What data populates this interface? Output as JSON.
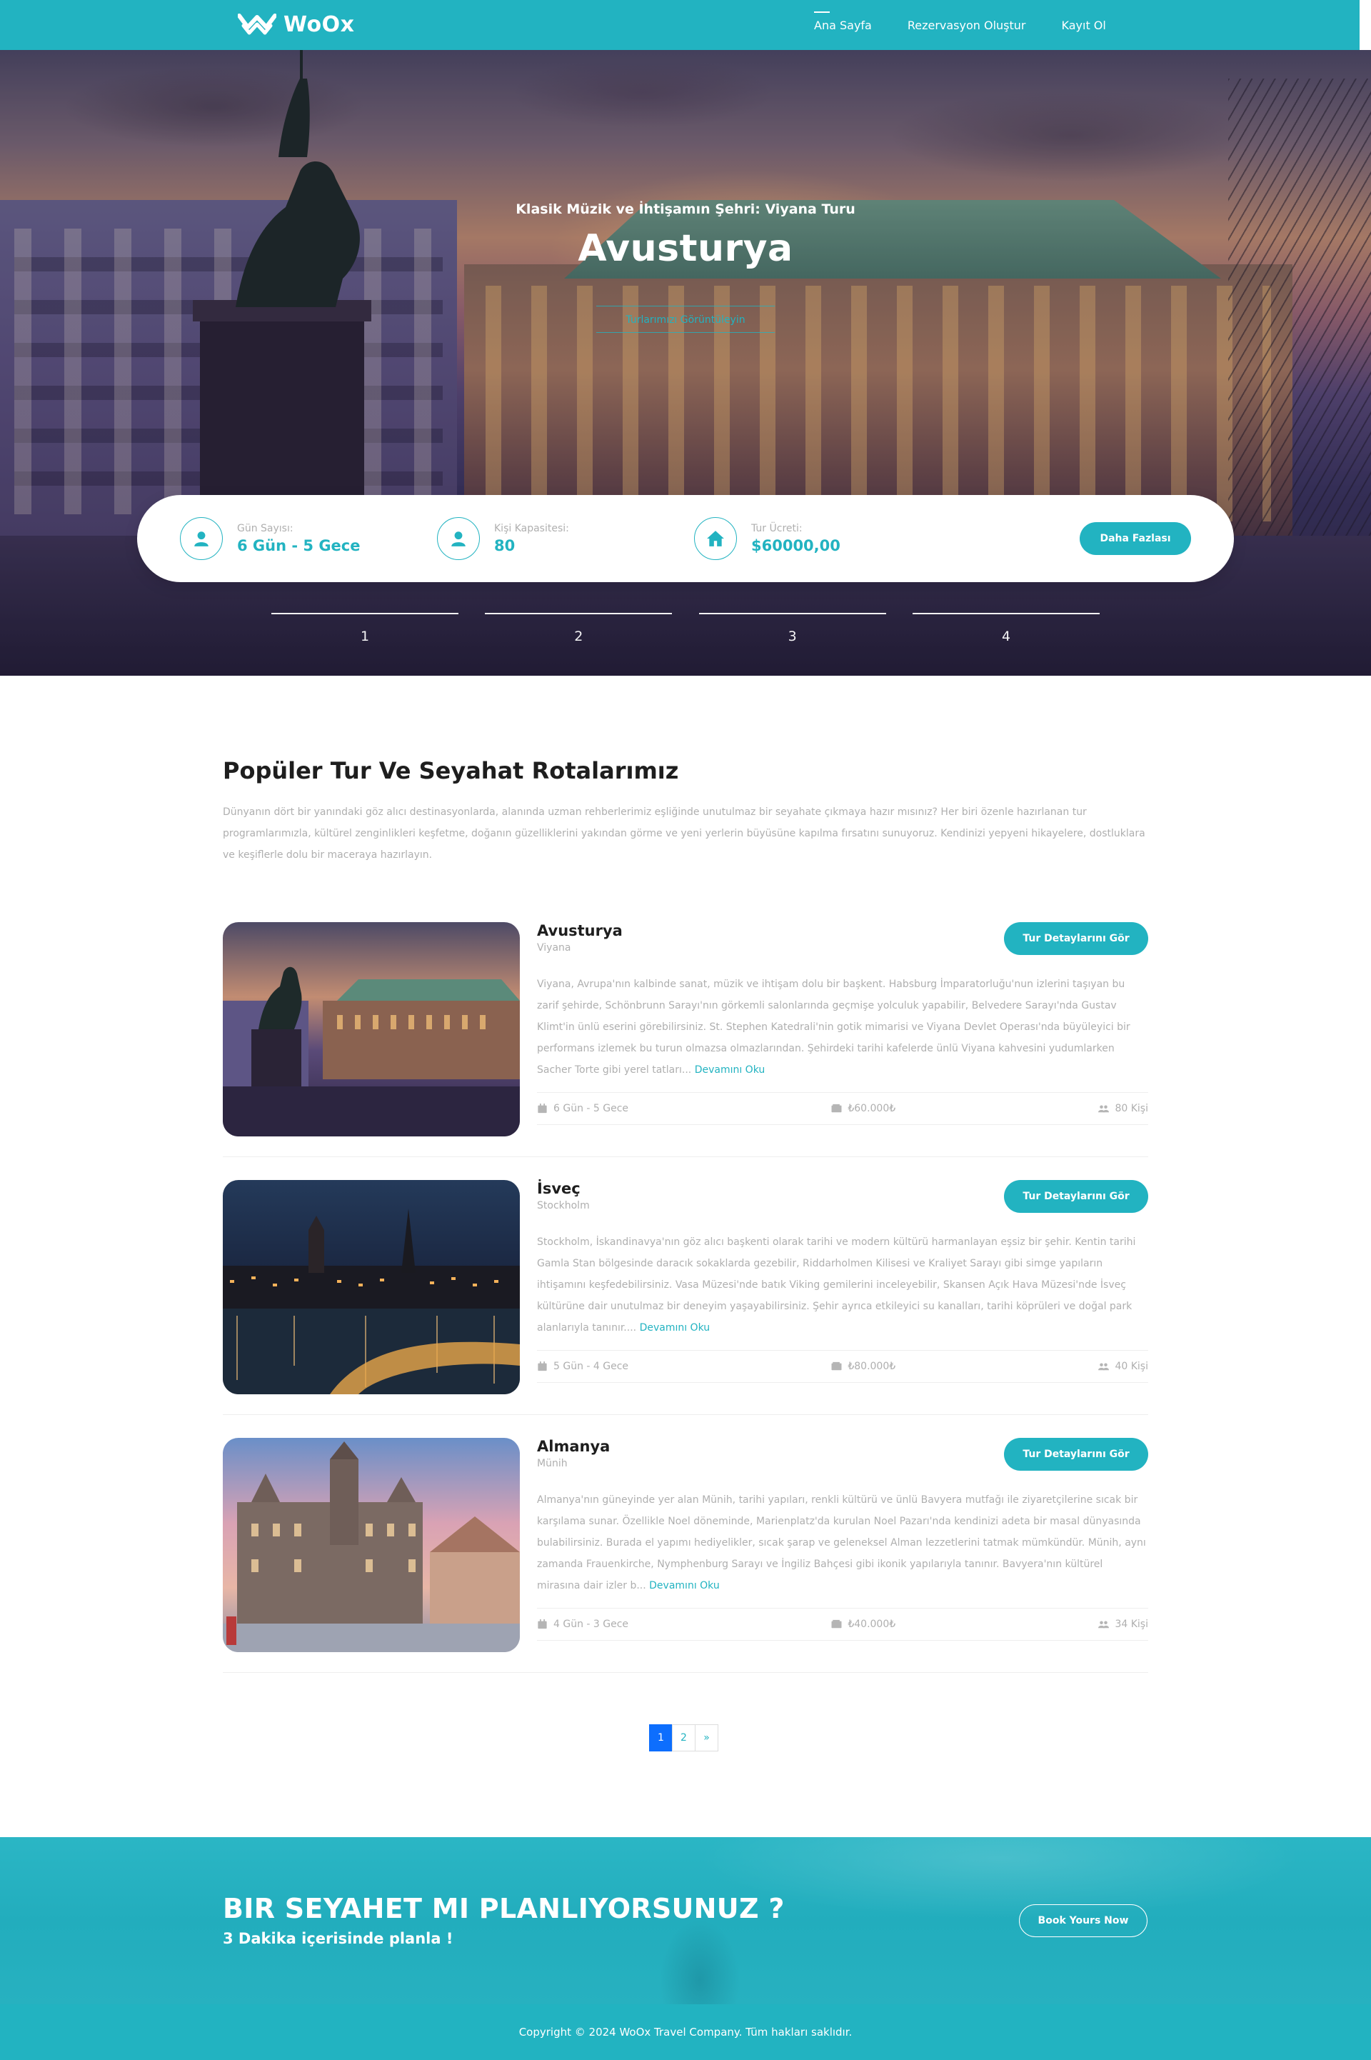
{
  "header": {
    "logo_text": "WoOx",
    "nav": [
      {
        "label": "Ana Sayfa",
        "active": true
      },
      {
        "label": "Rezervasyon Oluştur",
        "active": false
      },
      {
        "label": "Kayıt Ol",
        "active": false
      }
    ]
  },
  "hero": {
    "subtitle": "Klasik Müzik ve İhtişamın Şehri: Viyana Turu",
    "title": "Avusturya",
    "link_label": "Turlarımızı Görüntüleyin",
    "info": [
      {
        "label": "Gün Sayısı:",
        "value": "6 Gün - 5 Gece",
        "icon": "user-icon"
      },
      {
        "label": "Kişi Kapasitesi:",
        "value": "80",
        "icon": "user-icon"
      },
      {
        "label": "Tur Ücreti:",
        "value": "$60000,00",
        "icon": "home-icon"
      }
    ],
    "more_button": "Daha Fazlası",
    "slides": [
      "1",
      "2",
      "3",
      "4"
    ]
  },
  "section": {
    "title": "Popüler Tur Ve Seyahat Rotalarımız",
    "description": "Dünyanın dört bir yanındaki göz alıcı destinasyonlarda, alanında uzman rehberlerimiz eşliğinde unutulmaz bir seyahate çıkmaya hazır mısınız? Her biri özenle hazırlanan tur programlarımızla, kültürel zenginlikleri keşfetme, doğanın güzelliklerini yakından görme ve yeni yerlerin büyüsüne kapılma fırsatını sunuyoruz. Kendinizi yepyeni hikayelere, dostluklara ve keşiflerle dolu bir maceraya hazırlayın."
  },
  "tours": [
    {
      "name": "Avusturya",
      "city": "Viyana",
      "button": "Tur Detaylarını Gör",
      "description": "Viyana, Avrupa'nın kalbinde sanat, müzik ve ihtişam dolu bir başkent. Habsburg İmparatorluğu'nun izlerini taşıyan bu zarif şehirde, Schönbrunn Sarayı'nın görkemli salonlarında geçmişe yolculuk yapabilir, Belvedere Sarayı'nda Gustav Klimt'in ünlü eserini görebilirsiniz. St. Stephen Katedrali'nin gotik mimarisi ve Viyana Devlet Operası'nda büyüleyici bir performans izlemek bu turun olmazsa olmazlarından. Şehirdeki tarihi kafelerde ünlü Viyana kahvesini yudumlarken Sacher Torte gibi yerel tatları...",
      "read_more": "Devamını Oku",
      "duration": "6 Gün - 5 Gece",
      "price": "₺60.000₺",
      "capacity": "80 Kişi"
    },
    {
      "name": "İsveç",
      "city": "Stockholm",
      "button": "Tur Detaylarını Gör",
      "description": "Stockholm, İskandinavya'nın göz alıcı başkenti olarak tarihi ve modern kültürü harmanlayan eşsiz bir şehir. Kentin tarihi Gamla Stan bölgesinde daracık sokaklarda gezebilir, Riddarholmen Kilisesi ve Kraliyet Sarayı gibi simge yapıların ihtişamını keşfedebilirsiniz. Vasa Müzesi'nde batık Viking gemilerini inceleyebilir, Skansen Açık Hava Müzesi'nde İsveç kültürüne dair unutulmaz bir deneyim yaşayabilirsiniz. Şehir ayrıca etkileyici su kanalları, tarihi köprüleri ve doğal park alanlarıyla tanınır....",
      "read_more": "Devamını Oku",
      "duration": "5 Gün - 4 Gece",
      "price": "₺80.000₺",
      "capacity": "40 Kişi"
    },
    {
      "name": "Almanya",
      "city": "Münih",
      "button": "Tur Detaylarını Gör",
      "description": "Almanya'nın güneyinde yer alan Münih, tarihi yapıları, renkli kültürü ve ünlü Bavyera mutfağı ile ziyaretçilerine sıcak bir karşılama sunar. Özellikle Noel döneminde, Marienplatz'da kurulan Noel Pazarı'nda kendinizi adeta bir masal dünyasında bulabilirsiniz. Burada el yapımı hediyelikler, sıcak şarap ve geleneksel Alman lezzetlerini tatmak mümkündür. Münih, aynı zamanda Frauenkirche, Nymphenburg Sarayı ve İngiliz Bahçesi gibi ikonik yapılarıyla tanınır. Bavyera'nın kültürel mirasına dair izler b...",
      "read_more": "Devamını Oku",
      "duration": "4 Gün - 3 Gece",
      "price": "₺40.000₺",
      "capacity": "34 Kişi"
    }
  ],
  "pagination": {
    "pages": [
      "1",
      "2"
    ],
    "next": "»",
    "active": "1"
  },
  "cta": {
    "title": "BIR SEYAHET MI PLANLIYORSUNUZ ?",
    "subtitle": "3 Dakika içerisinde planla !",
    "button": "Book Yours Now"
  },
  "footer": {
    "copyright": "Copyright © 2024 WoOx Travel Company. Tüm hakları saklıdır."
  },
  "colors": {
    "accent": "#22b3c1",
    "text_muted": "#afafaf",
    "pagination_active": "#0d6efd"
  }
}
